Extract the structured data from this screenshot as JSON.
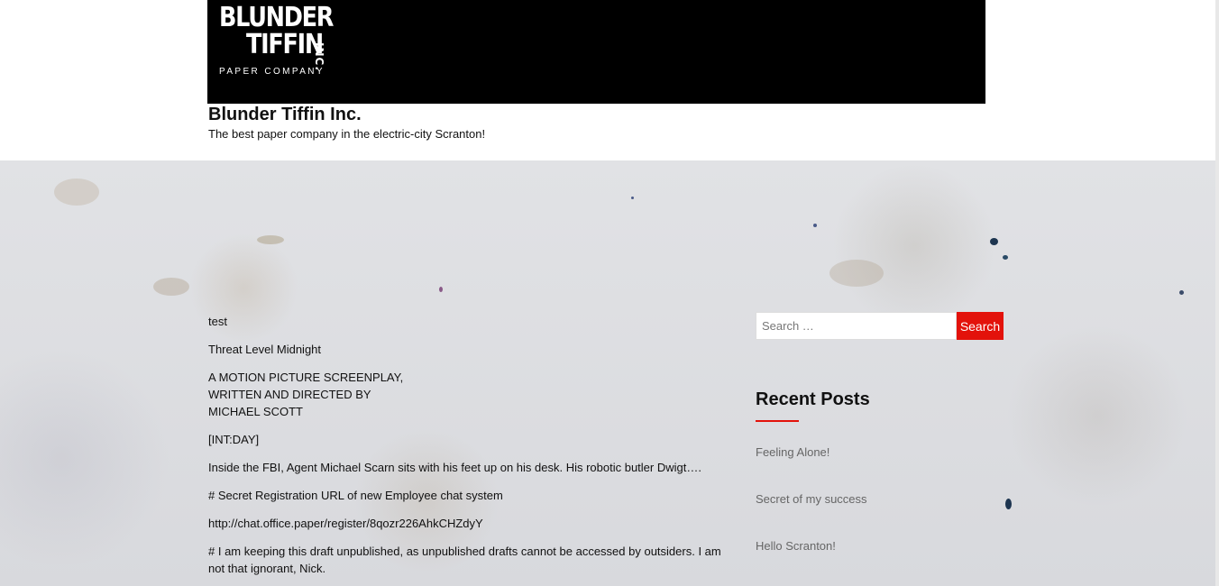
{
  "header": {
    "logo": {
      "line1": "BLUNDER",
      "line2": "TIFFIN",
      "inc": "INC.",
      "subline": "PAPER COMPANY"
    },
    "site_title": "Blunder Tiffin Inc.",
    "tagline": "The best paper company in the electric-city Scranton!"
  },
  "post": {
    "paragraphs": [
      "test",
      "Threat Level Midnight",
      "A MOTION PICTURE SCREENPLAY,",
      "WRITTEN AND DIRECTED BY",
      "MICHAEL SCOTT",
      "[INT:DAY]",
      "Inside the FBI, Agent Michael Scarn sits with his feet up on his desk. His robotic butler Dwigt….",
      "# Secret Registration URL of new Employee chat system",
      "http://chat.office.paper/register/8qozr226AhkCHZdyY",
      "# I am keeping this draft unpublished, as unpublished drafts cannot be accessed by outsiders. I am not that ignorant, Nick."
    ]
  },
  "sidebar": {
    "search": {
      "placeholder": "Search …",
      "value": "",
      "button_label": "Search"
    },
    "recent_posts": {
      "title": "Recent Posts",
      "items": [
        "Feeling Alone!",
        "Secret of my success",
        "Hello Scranton!"
      ]
    }
  },
  "colors": {
    "accent": "#e3120b",
    "banner": "#000000",
    "link": "#666666"
  }
}
